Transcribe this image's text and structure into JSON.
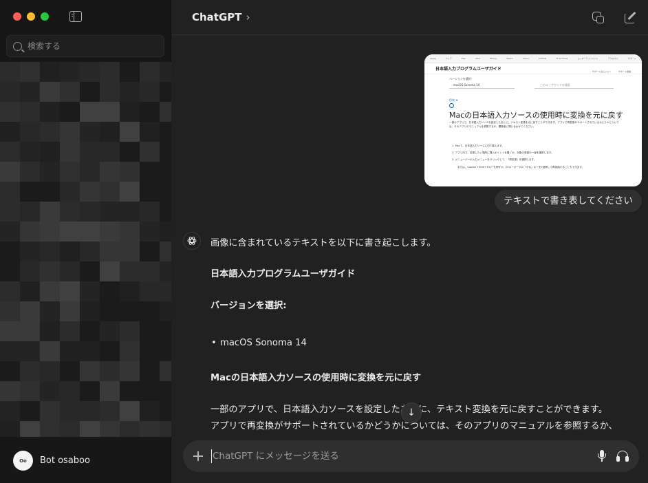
{
  "window": {
    "traffic_lights": {
      "close": "#ff5f57",
      "minimize": "#febc2e",
      "zoom": "#28c840"
    }
  },
  "sidebar": {
    "search_placeholder": "検索する",
    "user": {
      "name": "Bot osaboo"
    }
  },
  "header": {
    "title": "ChatGPT",
    "chevron": "›"
  },
  "conversation": {
    "attached_image": {
      "nav_items": [
        "Apple",
        "ストア",
        "Mac",
        "iPad",
        "iPhone",
        "Watch",
        "Vision",
        "AirPods",
        "TV & Home",
        "エンターテインメント",
        "アクセサリ",
        "サポート"
      ],
      "guide_title": "日本語入力プログラムユーザガイド",
      "guide_links": [
        "サポートのビジョン",
        "サポート連絡"
      ],
      "version_label": "バージョンを選択:",
      "version_value": "macOS Sonoma 14",
      "search_placeholder": "このユーザガイドを検索",
      "back_link": "目次 ⊕",
      "heading": "Macの日本語入力ソースの使用時に変換を元に戻す",
      "paragraph": "一部のアプリで、日本語入力ソースを設定したあとに、テキスト変換を元に戻すことができます。アプリで再変換がサポートされているかどうかについては、そのアプリのマニュアルを参照するか、開発者に問い合わせてください。",
      "steps": [
        "1. Macで、日本語入力ソースに切り替えます。",
        "2. アプリ内で、変更したい場所に挿入ポイントを置くか、対象の単語の一部を選択します。",
        "3. メニューバーの入力メニューをクリックして、「再変換」を選択します。",
        "または、Control＋Shift＋Rキーを押すか、JISキーボードの「かな」キーを2回押して再変換することもできます。"
      ]
    },
    "user_message": "テキストで書き表してください",
    "assistant": {
      "intro": "画像に含まれているテキストを以下に書き起こします。",
      "guide_title": "日本語入力プログラムユーザガイド",
      "version_heading": "バージョンを選択:",
      "bullet_glyph": "•",
      "version_item": "macOS Sonoma 14",
      "section_heading": "Macの日本語入力ソースの使用時に変換を元に戻す",
      "body_line_1": "一部のアプリで、日本語入力ソースを設定したあとに、テキスト変換を元に戻すことができます。",
      "body_line_2": "アプリで再変換がサポートされているかどうかについては、そのアプリのマニュアルを参照するか、"
    },
    "scroll_down_glyph": "↓"
  },
  "composer": {
    "placeholder": "ChatGPT にメッセージを送る"
  },
  "colors": {
    "background": "#212121",
    "sidebar": "#171717",
    "bubble": "#303030",
    "composer": "#2f2f2f",
    "text": "#ececec",
    "muted": "#8e8e8e"
  }
}
